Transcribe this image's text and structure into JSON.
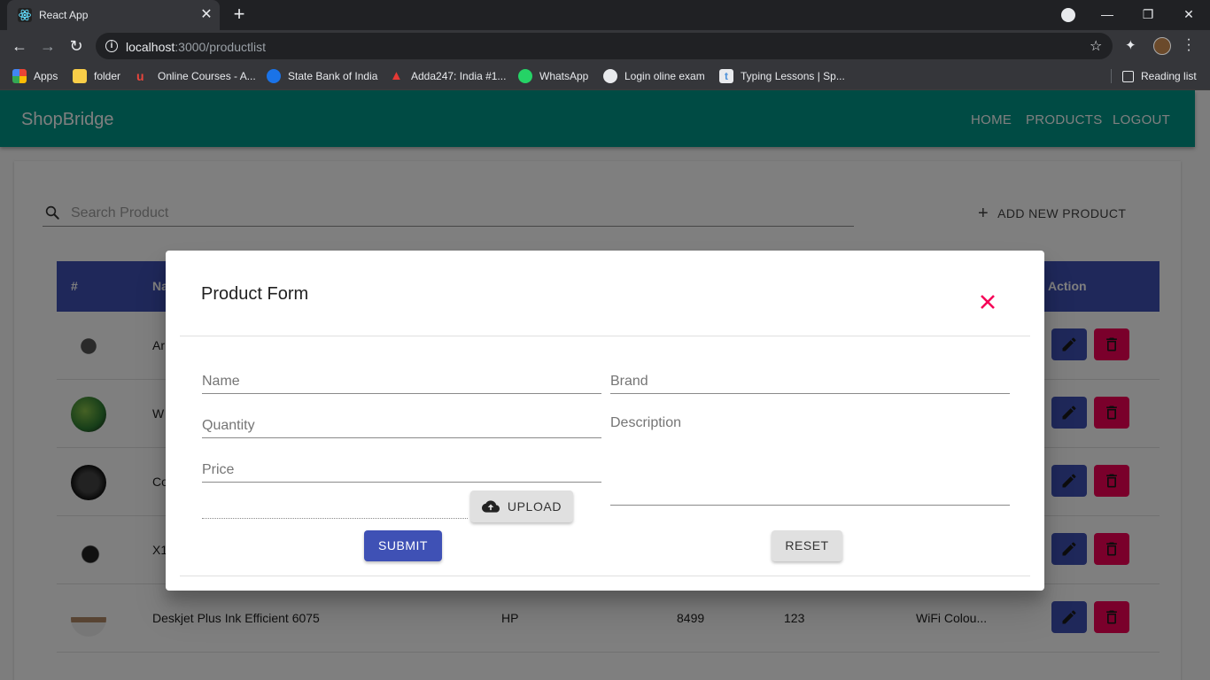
{
  "browser": {
    "tab_title": "React App",
    "url_host": "localhost",
    "url_rest": ":3000/productlist",
    "bookmarks": [
      {
        "label": "Apps",
        "color": "#4285f4"
      },
      {
        "label": "folder",
        "color": "#f9ce48"
      },
      {
        "label": "Online Courses - A...",
        "color": "#e8453c"
      },
      {
        "label": "State Bank of India",
        "color": "#1a73e8"
      },
      {
        "label": "Adda247: India #1...",
        "color": "#e53935"
      },
      {
        "label": "WhatsApp",
        "color": "#25d366"
      },
      {
        "label": "Login oline exam",
        "color": "#e8eaed"
      },
      {
        "label": "Typing Lessons | Sp...",
        "color": "#4a90d9"
      }
    ],
    "reading_list": "Reading list"
  },
  "app": {
    "brand": "ShopBridge",
    "nav": [
      "HOME",
      "PRODUCTS",
      "LOGOUT"
    ],
    "search_placeholder": "Search Product",
    "add_label": "ADD NEW PRODUCT",
    "table": {
      "headers": {
        "index": "#",
        "name": "Na",
        "action": "Action"
      },
      "rows": [
        {
          "name": "Ar",
          "brand": "",
          "price": "",
          "quantity": "",
          "description": "",
          "thumb_color": "#333333"
        },
        {
          "name": "W",
          "brand": "",
          "price": "",
          "quantity": "",
          "description": "",
          "thumb_color": "#4caf50"
        },
        {
          "name": "Co",
          "brand": "",
          "price": "",
          "quantity": "",
          "description": "",
          "thumb_color": "#1b1b1b"
        },
        {
          "name": "X1",
          "brand": "",
          "price": "",
          "quantity": "",
          "description": "",
          "thumb_color": "#d9d9d9"
        },
        {
          "name": "Deskjet Plus Ink Efficient 6075",
          "brand": "HP",
          "price": "8499",
          "quantity": "123",
          "description": "WiFi Colou...",
          "thumb_color": "#c9b8a6"
        }
      ]
    }
  },
  "modal": {
    "title": "Product Form",
    "fields": {
      "name": "Name",
      "brand": "Brand",
      "quantity": "Quantity",
      "description": "Description",
      "price": "Price"
    },
    "upload_label": "UPLOAD",
    "submit_label": "SUBMIT",
    "reset_label": "RESET"
  },
  "colors": {
    "appbar": "#009688",
    "primary": "#3f51b5",
    "secondary": "#f50057"
  },
  "icons": [
    "react-icon",
    "close-icon",
    "search-icon",
    "plus-icon",
    "edit-icon",
    "delete-icon",
    "cloud-upload-icon",
    "star-icon",
    "extensions-icon"
  ]
}
